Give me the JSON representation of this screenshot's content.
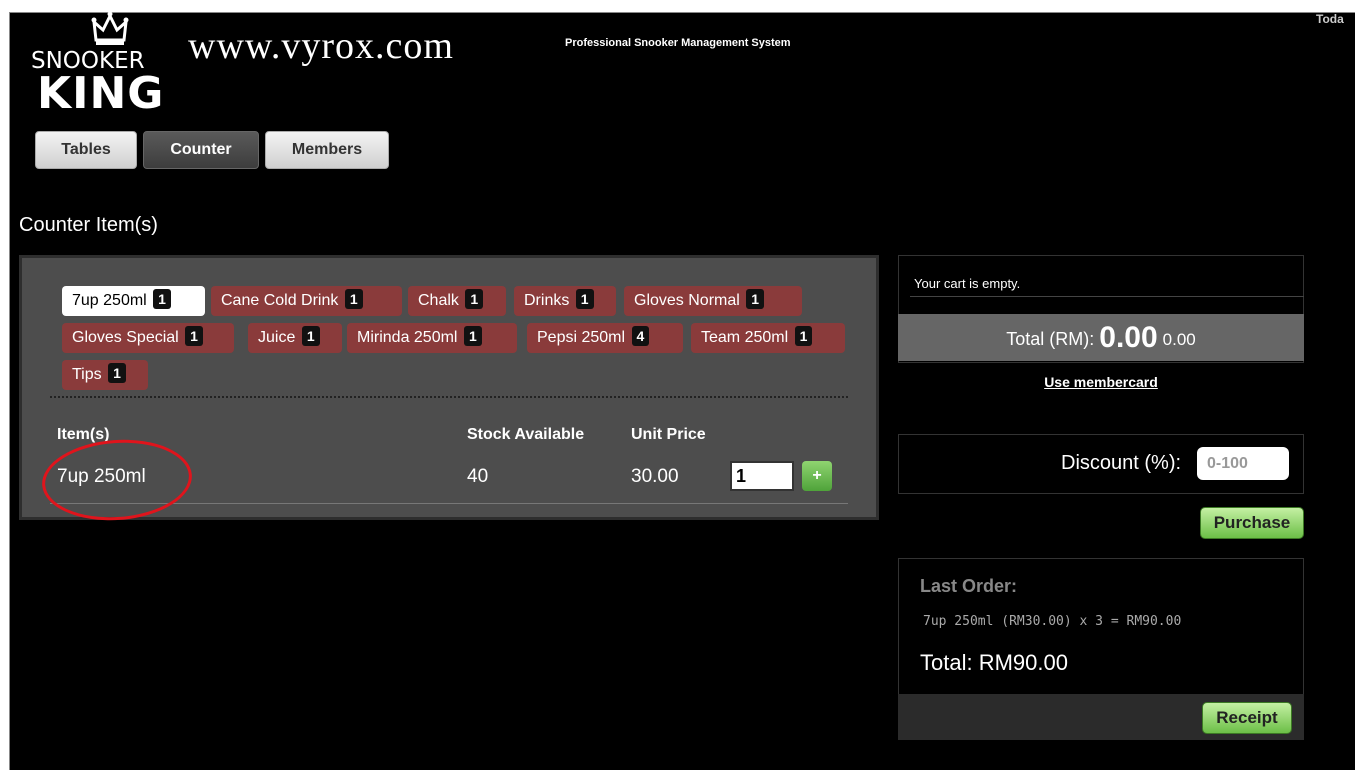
{
  "header": {
    "logo_top": "SNOOKER",
    "logo_bottom": "KING",
    "site": "www.vyrox.com",
    "tagline": "Professional Snooker Management System",
    "date_label": "Toda"
  },
  "nav": {
    "tables": "Tables",
    "counter": "Counter",
    "members": "Members",
    "active": "Counter"
  },
  "counter": {
    "title": "Counter Item(s)",
    "chips": [
      {
        "label": "7up 250ml",
        "count": "1",
        "active": true
      },
      {
        "label": "Cane Cold Drink",
        "count": "1"
      },
      {
        "label": "Chalk",
        "count": "1"
      },
      {
        "label": "Drinks",
        "count": "1"
      },
      {
        "label": "Gloves Normal",
        "count": "1"
      },
      {
        "label": "Gloves Special",
        "count": "1"
      },
      {
        "label": "Juice",
        "count": "1"
      },
      {
        "label": "Mirinda 250ml",
        "count": "1"
      },
      {
        "label": "Pepsi 250ml",
        "count": "4"
      },
      {
        "label": "Team 250ml",
        "count": "1"
      },
      {
        "label": "Tips",
        "count": "1"
      }
    ],
    "table": {
      "headers": {
        "item": "Item(s)",
        "stock": "Stock Available",
        "price": "Unit Price"
      },
      "row": {
        "item": "7up 250ml",
        "stock": "40",
        "price": "30.00",
        "qty": "1",
        "add": "+"
      }
    }
  },
  "cart": {
    "empty_text": "Your cart is empty.",
    "total_label": "Total (RM):",
    "total_big": "0.00",
    "total_small": "0.00",
    "membercard": "Use membercard",
    "discount_label": "Discount (%):",
    "discount_placeholder": "0-100",
    "purchase": "Purchase"
  },
  "last_order": {
    "title": "Last Order:",
    "line": "7up 250ml (RM30.00) x 3 = RM90.00",
    "total": "Total: RM90.00",
    "receipt": "Receipt"
  },
  "colors": {
    "chip": "#8a3b3b",
    "green_button": "#6cbf47",
    "annotation_circle": "#e0141c"
  }
}
